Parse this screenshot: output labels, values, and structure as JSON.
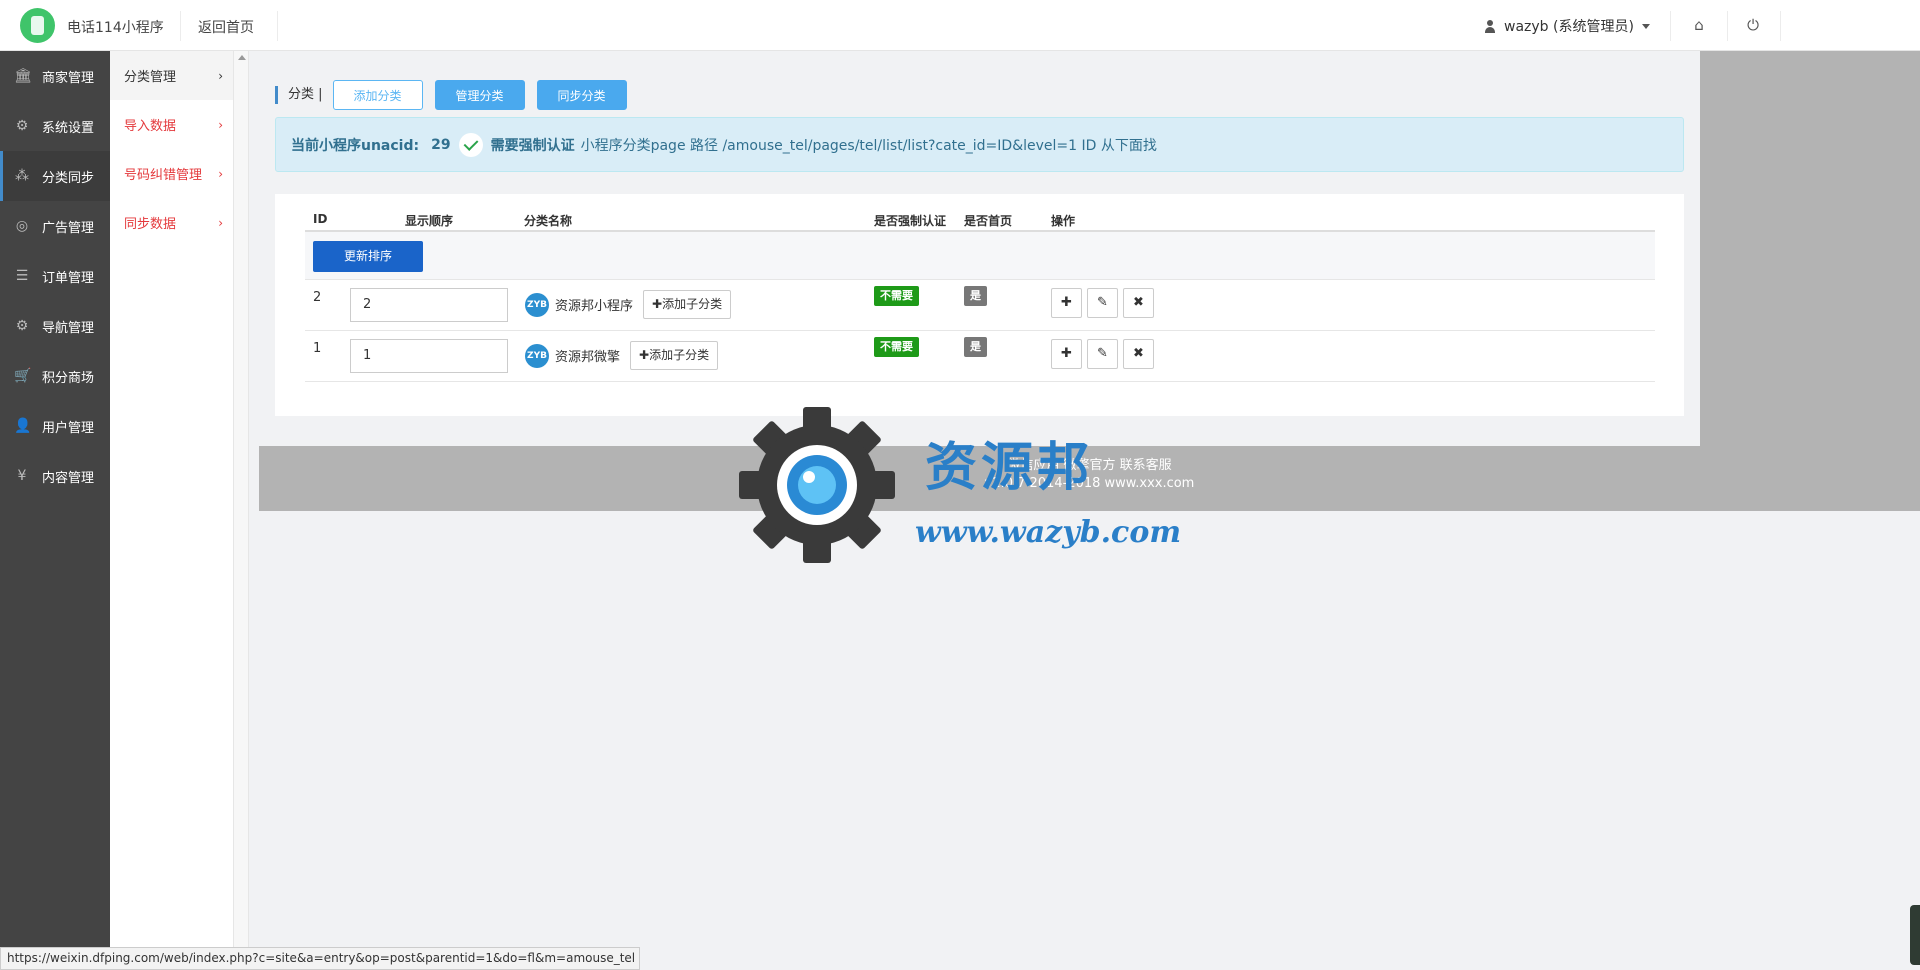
{
  "header": {
    "app_title": "电话114小程序",
    "back_home": "返回首页",
    "user": "wazyb (系统管理员)"
  },
  "sidebar": {
    "items": [
      {
        "label": "商家管理",
        "icon": "bank-icon"
      },
      {
        "label": "系统设置",
        "icon": "gear-icon"
      },
      {
        "label": "分类同步",
        "icon": "cubes-icon",
        "active": true
      },
      {
        "label": "广告管理",
        "icon": "lifebuoy-icon"
      },
      {
        "label": "订单管理",
        "icon": "list-icon"
      },
      {
        "label": "导航管理",
        "icon": "cogs-icon"
      },
      {
        "label": "积分商场",
        "icon": "cart-icon"
      },
      {
        "label": "用户管理",
        "icon": "user-icon"
      },
      {
        "label": "内容管理",
        "icon": "yen-icon"
      }
    ]
  },
  "submenu": {
    "items": [
      {
        "label": "分类管理"
      },
      {
        "label": "导入数据"
      },
      {
        "label": "号码纠错管理"
      },
      {
        "label": "同步数据"
      }
    ]
  },
  "toolbar": {
    "crumb": "分类 |",
    "add_label": "添加分类",
    "manage_label": "管理分类",
    "sync_label": "同步分类"
  },
  "alert": {
    "prefix": "当前小程序unacid:",
    "unacid": "29",
    "force_auth": "需要强制认证",
    "path_text": "小程序分类page 路径 /amouse_tel/pages/tel/list/list?cate_id=ID&level=1 ID 从下面找"
  },
  "table": {
    "headers": {
      "id": "ID",
      "order": "显示顺序",
      "name": "分类名称",
      "force": "是否强制认证",
      "home": "是否首页",
      "ops": "操作"
    },
    "sort_button": "更新排序",
    "add_child": "✚添加子分类",
    "rows": [
      {
        "id": "2",
        "order": "2",
        "name": "资源邦小程序",
        "force": "不需要",
        "home": "是"
      },
      {
        "id": "1",
        "order": "1",
        "name": "资源邦微擎",
        "force": "不需要",
        "home": "是"
      }
    ]
  },
  "footer": {
    "line1": "微信应用 微擎官方 联系客服",
    "line2": "v2.0.7 2014-2018 www.xxx.com"
  },
  "watermark": {
    "title": "资源邦",
    "url": "www.wazyb.com"
  },
  "statusbar": {
    "url": "https://weixin.dfping.com/web/index.php?c=site&a=entry&op=post&parentid=1&do=fl&m=amouse_tel"
  }
}
